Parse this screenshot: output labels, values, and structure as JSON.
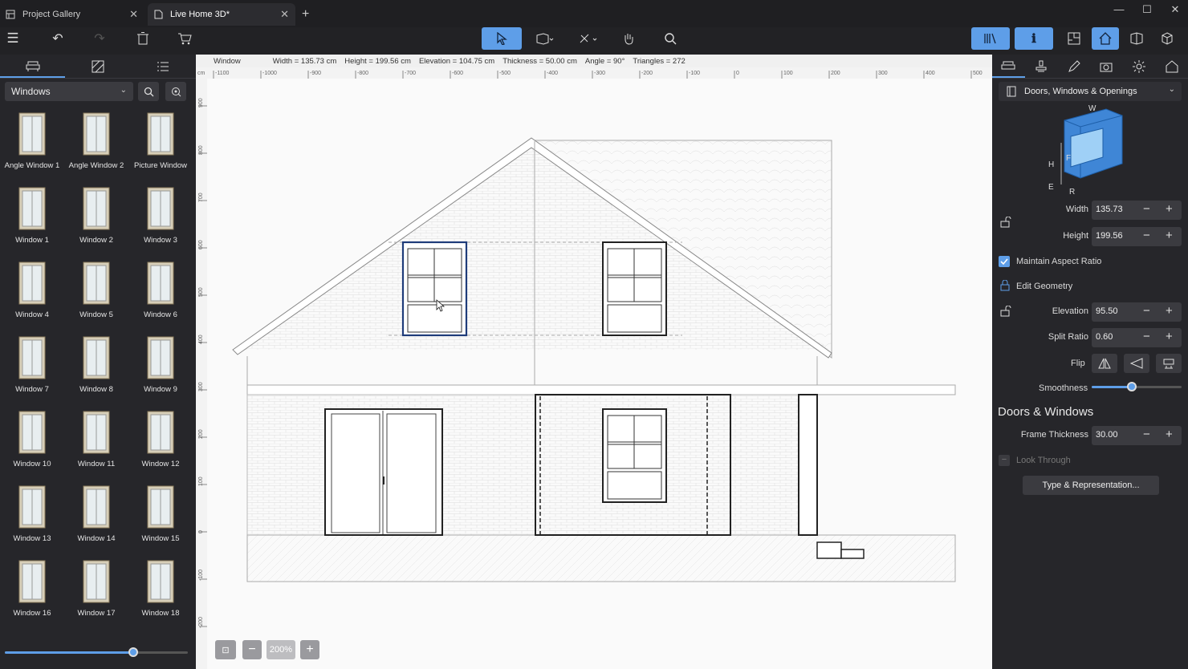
{
  "tabs": [
    {
      "label": "Project Gallery",
      "icon": "gallery-icon",
      "active": false
    },
    {
      "label": "Live Home 3D*",
      "icon": "document-icon",
      "active": true
    }
  ],
  "left_panel": {
    "category": "Windows",
    "items": [
      {
        "label": "Angle Window 1"
      },
      {
        "label": "Angle Window 2"
      },
      {
        "label": "Picture Window"
      },
      {
        "label": "Window 1"
      },
      {
        "label": "Window 2"
      },
      {
        "label": "Window 3"
      },
      {
        "label": "Window 4"
      },
      {
        "label": "Window 5"
      },
      {
        "label": "Window 6"
      },
      {
        "label": "Window 7"
      },
      {
        "label": "Window 8"
      },
      {
        "label": "Window 9"
      },
      {
        "label": "Window 10"
      },
      {
        "label": "Window 11"
      },
      {
        "label": "Window 12"
      },
      {
        "label": "Window 13"
      },
      {
        "label": "Window 14"
      },
      {
        "label": "Window 15"
      },
      {
        "label": "Window 16"
      },
      {
        "label": "Window 17"
      },
      {
        "label": "Window 18"
      }
    ],
    "thumb_size_fraction": 0.7
  },
  "info_bar": {
    "object": "Window",
    "width": "Width = 135.73 cm",
    "height": "Height = 199.56 cm",
    "elevation": "Elevation = 104.75 cm",
    "thickness": "Thickness = 50.00 cm",
    "angle": "Angle = 90°",
    "triangles": "Triangles = 272"
  },
  "ruler": {
    "unit": "cm",
    "top_ticks": [
      "-1100",
      "-1000",
      "-900",
      "-800",
      "-700",
      "-600",
      "-500",
      "-400",
      "-300",
      "-200",
      "-100",
      "0",
      "100",
      "200",
      "300",
      "400",
      "500"
    ],
    "left_ticks": [
      "900",
      "800",
      "700",
      "600",
      "500",
      "400",
      "300",
      "200",
      "100",
      "0",
      "-100",
      "-200"
    ]
  },
  "zoom": {
    "level": "200%"
  },
  "right_panel": {
    "category": "Doors, Windows & Openings",
    "diagram_labels": {
      "w": "W",
      "h": "H",
      "f": "F",
      "e": "E",
      "r": "R"
    },
    "width_label": "Width",
    "width_value": "135.73",
    "height_label": "Height",
    "height_value": "199.56",
    "maintain_aspect": "Maintain Aspect Ratio",
    "edit_geometry": "Edit Geometry",
    "elevation_label": "Elevation",
    "elevation_value": "95.50",
    "split_label": "Split Ratio",
    "split_value": "0.60",
    "flip_label": "Flip",
    "smoothness_label": "Smoothness",
    "smoothness_value": 0.45,
    "section_title": "Doors & Windows",
    "frame_label": "Frame Thickness",
    "frame_value": "30.00",
    "look_through": "Look Through",
    "type_button": "Type & Representation..."
  },
  "colors": {
    "accent": "#5e9ee8",
    "panel": "#26262a",
    "canvas": "#fafafa"
  }
}
